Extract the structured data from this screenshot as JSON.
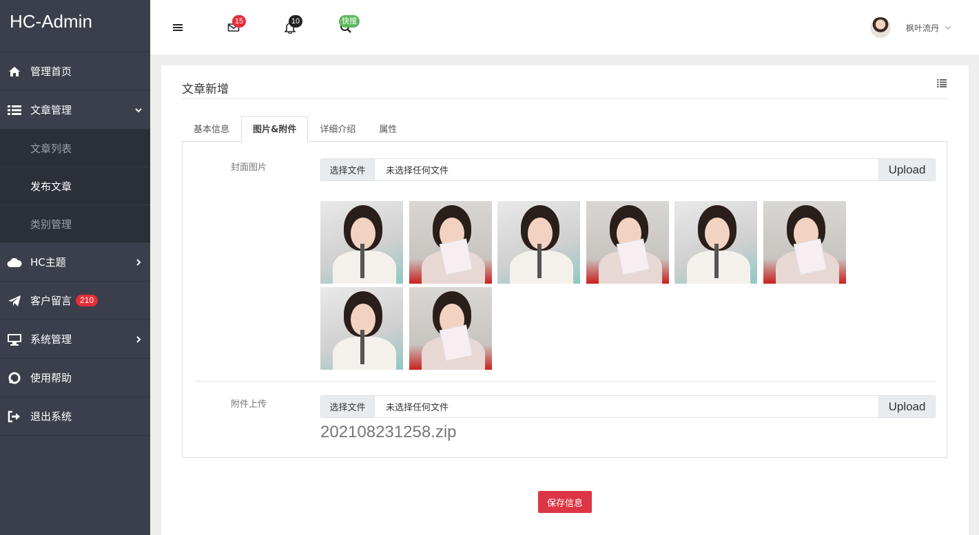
{
  "app": {
    "brand": "HC-Admin"
  },
  "sidebar": {
    "items": [
      {
        "label": "管理首页",
        "icon": "home-icon"
      },
      {
        "label": "文章管理",
        "icon": "list-icon",
        "expanded": true,
        "children": [
          {
            "label": "文章列表"
          },
          {
            "label": "发布文章",
            "active": true
          },
          {
            "label": "类别管理"
          }
        ]
      },
      {
        "label": "HC主题",
        "icon": "cloud-icon"
      },
      {
        "label": "客户留言",
        "icon": "paper-plane-icon",
        "badge": "210"
      },
      {
        "label": "系统管理",
        "icon": "desktop-icon"
      },
      {
        "label": "使用帮助",
        "icon": "life-ring-icon"
      },
      {
        "label": "退出系统",
        "icon": "sign-out-icon"
      }
    ]
  },
  "header": {
    "menu_icon": "hamburger-icon",
    "mail_badge": "15",
    "bell_badge": "10",
    "search_badge": "快搜",
    "user_name": "枫叶流丹",
    "colors": {
      "mail_badge": "#e52d3a",
      "bell_badge": "#222222",
      "search_badge": "#5cb85c"
    }
  },
  "page": {
    "title": "文章新增",
    "tabs": [
      {
        "label": "基本信息"
      },
      {
        "label": "图片&附件",
        "active": true
      },
      {
        "label": "详细介绍"
      },
      {
        "label": "属性"
      }
    ],
    "cover": {
      "label": "封面图片",
      "choose_label": "选择文件",
      "file_text": "未选择任何文件",
      "upload_label": "Upload",
      "image_count": 8
    },
    "attachment": {
      "label": "附件上传",
      "choose_label": "选择文件",
      "file_text": "未选择任何文件",
      "upload_label": "Upload",
      "file_name": "202108231258.zip"
    },
    "save_label": "保存信息"
  },
  "colors": {
    "sidebar_bg": "#3a3f4b",
    "submenu_bg": "#2b2f38",
    "danger": "#dc3545"
  }
}
